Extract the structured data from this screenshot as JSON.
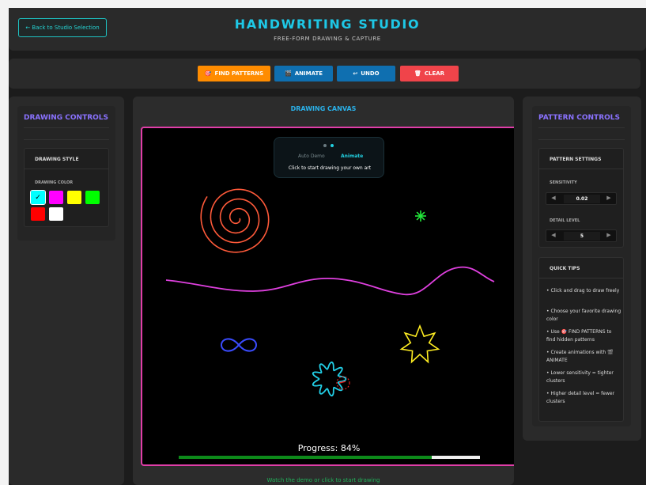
{
  "header": {
    "back_label": "← Back to Studio Selection",
    "title": "HANDWRITING STUDIO",
    "subtitle": "FREE-FORM DRAWING & CAPTURE"
  },
  "toolbar": {
    "find_icon": "🎯",
    "find_label": "FIND PATTERNS",
    "animate_icon": "🎬",
    "animate_label": "ANIMATE",
    "undo_icon": "↩",
    "undo_label": "UNDO",
    "clear_icon": "🗑",
    "clear_label": "CLEAR"
  },
  "drawing_controls": {
    "title": "DRAWING CONTROLS",
    "style_title": "DRAWING STYLE",
    "color_label": "DRAWING COLOR",
    "colors": [
      "#00ffff",
      "#ff00ff",
      "#ffff00",
      "#00ff00",
      "#ff0000",
      "#ffffff"
    ],
    "selected_color": "#00ffff",
    "check": "✓"
  },
  "canvas": {
    "title": "DRAWING CANVAS",
    "demo_tab_auto": "Auto Demo",
    "demo_tab_animate": "Animate",
    "demo_hint": "Click to start drawing your own art",
    "progress_label": "Progress: 84%",
    "progress": 0.84,
    "footer_hint": "Watch the demo or click to start drawing",
    "stroke_colors": {
      "spiral": "#ff5a3a",
      "wave": "#e040e0",
      "burst": "#22e83a",
      "infinity": "#3a4cff",
      "star": "#ffee22",
      "blob": "#22d0e8",
      "cursor": "#e02020"
    }
  },
  "pattern_controls": {
    "title": "PATTERN CONTROLS",
    "settings_title": "PATTERN SETTINGS",
    "sensitivity_label": "SENSITIVITY",
    "sensitivity_value": "0.02",
    "detail_label": "DETAIL LEVEL",
    "detail_value": "5",
    "left_arrow": "◀",
    "right_arrow": "▶",
    "tips_title": "QUICK TIPS",
    "tips": [
      "• Click and drag to draw freely",
      "• Choose your favorite drawing color",
      "• Use 🎯 FIND PATTERNS to find hidden patterns",
      "• Create animations with 🎬 ANIMATE",
      "• Lower sensitivity = tighter clusters",
      "• Higher detail level = fewer clusters"
    ]
  }
}
